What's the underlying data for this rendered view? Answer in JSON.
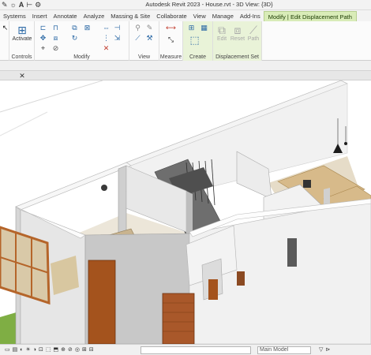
{
  "app": {
    "title": "Autodesk Revit 2023 - House.rvt - 3D View: {3D}"
  },
  "quick_access": [
    "hand-icon",
    "sun-icon",
    "text-A-icon",
    "ruler-icon",
    "gear-icon"
  ],
  "tabs": [
    {
      "label": "Systems",
      "active": false
    },
    {
      "label": "Insert",
      "active": false
    },
    {
      "label": "Annotate",
      "active": false
    },
    {
      "label": "Analyze",
      "active": false
    },
    {
      "label": "Massing & Site",
      "active": false
    },
    {
      "label": "Collaborate",
      "active": false
    },
    {
      "label": "View",
      "active": false
    },
    {
      "label": "Manage",
      "active": false
    },
    {
      "label": "Add-Ins",
      "active": false
    },
    {
      "label": "Modify | Edit Displacement Path",
      "active": true
    }
  ],
  "ribbon": {
    "panels": {
      "controls": "Controls",
      "modify": "Modify",
      "view": "View",
      "measure": "Measure",
      "create": "Create",
      "displacement_set": "Displacement Set"
    },
    "buttons": {
      "activate": "Activate",
      "edit": "Edit",
      "reset": "Reset",
      "path": "Path"
    }
  },
  "status": {
    "selection_filter": "Main Model",
    "zoom_box_value": ""
  },
  "colors": {
    "accent_tab": "#d9ecb8",
    "floor_wood": "#e0c99a",
    "door_brown": "#a4531d",
    "grass": "#7fae44",
    "window_frame": "#b5652a"
  }
}
